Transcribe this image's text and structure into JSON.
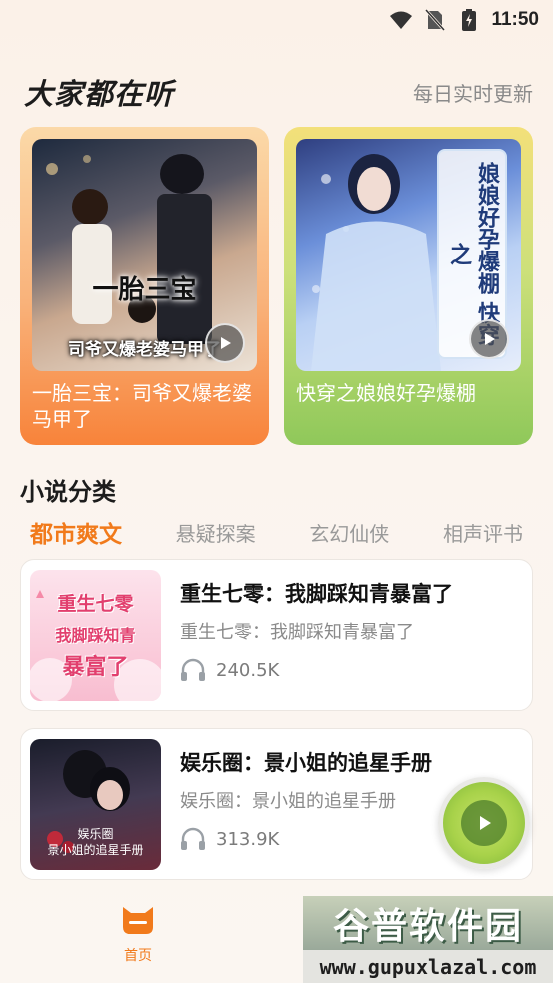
{
  "status_bar": {
    "time": "11:50",
    "icons": [
      "wifi-icon",
      "no-sim-icon",
      "battery-charging-icon"
    ]
  },
  "header": {
    "title": "大家都在听",
    "subtitle": "每日实时更新"
  },
  "featured": [
    {
      "title": "一胎三宝：司爷又爆老婆马甲了",
      "cover_caption": "一胎三宝",
      "cover_subcaption": "司爷又爆老婆马甲了",
      "accent": "#f8833a"
    },
    {
      "title": "快穿之娘娘好孕爆棚",
      "cover_caption": "娘娘好孕爆棚 快穿之",
      "accent": "#8fc85a"
    }
  ],
  "category": {
    "title": "小说分类",
    "tabs": [
      "都市爽文",
      "悬疑探案",
      "玄幻仙侠",
      "相声评书"
    ],
    "active_tab": "都市爽文"
  },
  "books": [
    {
      "title": "重生七零：我脚踩知青暴富了",
      "description": "重生七零：我脚踩知青暴富了",
      "plays": "240.5K",
      "cover_lines": [
        "重生七零",
        "我脚踩知青",
        "暴富了"
      ]
    },
    {
      "title": "娱乐圈：景小姐的追星手册",
      "description": "娱乐圈：景小姐的追星手册",
      "plays": "313.9K",
      "cover_lines": [
        "娱乐圈",
        "景小姐的追星手册"
      ]
    }
  ],
  "bottom_nav": {
    "home_label": "首页"
  },
  "watermark": {
    "brand": "谷普软件园",
    "url": "www.gupuxlazal.com"
  },
  "colors": {
    "accent_orange": "#f17a1b",
    "background": "#fbf3ec"
  }
}
